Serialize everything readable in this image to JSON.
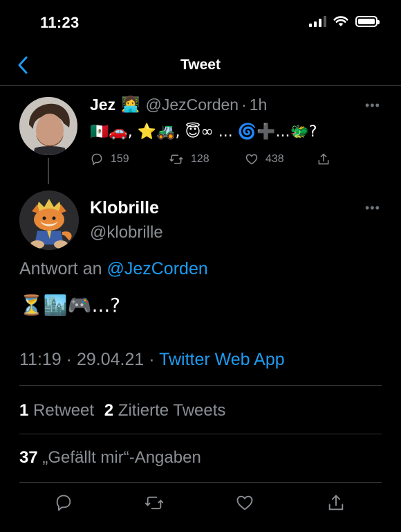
{
  "status_bar": {
    "time": "11:23"
  },
  "nav": {
    "title": "Tweet"
  },
  "parent_tweet": {
    "name": "Jez",
    "name_emoji": "👩‍💻",
    "handle": "@JezCorden",
    "separator": "·",
    "time": "1h",
    "text": "🇲🇽🚗, ⭐🚜, 😇∞ ... 🌀➕...🐲?",
    "replies": "159",
    "retweets": "128",
    "likes": "438"
  },
  "tweet": {
    "name": "Klobrille",
    "handle": "@klobrille",
    "reply_prefix": "Antwort an",
    "reply_to": "@JezCorden",
    "text": "⏳🏙️🎮...?",
    "time": "11:19",
    "date_sep": "·",
    "date": "29.04.21",
    "source_sep": "·",
    "source": "Twitter Web App"
  },
  "stats": {
    "retweets_count": "1",
    "retweets_label": "Retweet",
    "quotes_count": "2",
    "quotes_label": "Zitierte Tweets",
    "likes_count": "37",
    "likes_label": "„Gefällt mir“-Angaben"
  },
  "colors": {
    "background": "#000000",
    "accent": "#1d9bf0",
    "secondary_text": "#8b8f94",
    "divider": "#2f3336"
  },
  "icons": {
    "back": "chevron-left-icon",
    "reply": "reply-icon",
    "retweet": "retweet-icon",
    "like": "heart-icon",
    "share": "share-icon",
    "more": "more-icon"
  }
}
